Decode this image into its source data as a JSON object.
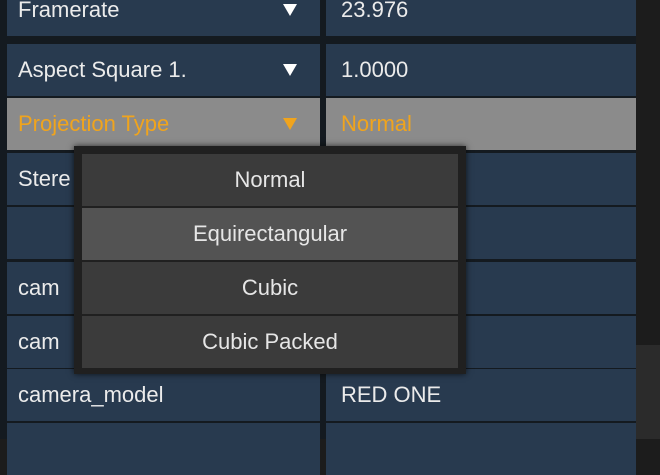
{
  "properties": [
    {
      "name": "Framerate",
      "value": "23.976",
      "dropdown": true
    },
    {
      "name": "Aspect Square 1.",
      "value": "1.0000",
      "dropdown": true
    },
    {
      "name": "Projection Type",
      "value": "Normal",
      "dropdown": true
    },
    {
      "name": "Stere",
      "value": "",
      "dropdown": false
    },
    {
      "name": "",
      "value": "",
      "dropdown": false
    },
    {
      "name": "cam",
      "value": "",
      "dropdown": false
    },
    {
      "name": "cam",
      "value": "",
      "dropdown": false
    },
    {
      "name": "camera_model",
      "value": "RED ONE",
      "dropdown": false
    }
  ],
  "selected_row": "Projection Type",
  "dropdown_menu": {
    "options": [
      "Normal",
      "Equirectangular",
      "Cubic",
      "Cubic Packed"
    ],
    "highlighted": "Equirectangular"
  },
  "colors": {
    "row_bg": "#283a4f",
    "selected_row_bg": "#8b8b8b",
    "selected_text": "#f0a41d",
    "text": "#ebebeb",
    "menu_bg": "#3b3b3b",
    "menu_hover_bg": "#535353"
  }
}
